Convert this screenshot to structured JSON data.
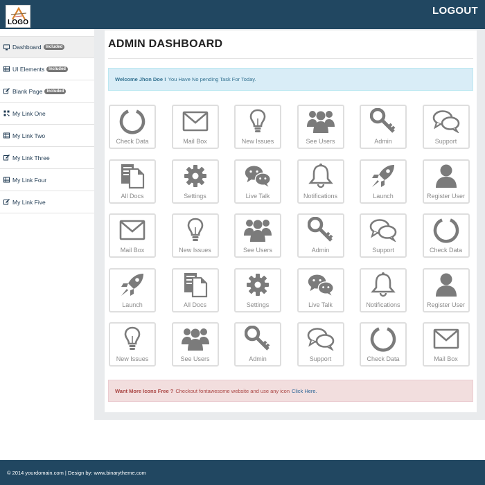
{
  "header": {
    "logo_text": "LOGO",
    "logout_label": "LOGOUT"
  },
  "sidebar": {
    "items": [
      {
        "label": "Dashboard",
        "badge": "Included",
        "icon": "desktop-icon",
        "active": true
      },
      {
        "label": "UI Elements",
        "badge": "Included",
        "icon": "table-icon",
        "active": false
      },
      {
        "label": "Blank Page",
        "badge": "Included",
        "icon": "edit-icon",
        "active": false
      },
      {
        "label": "My Link One",
        "badge": "",
        "icon": "qrcode-icon",
        "active": false
      },
      {
        "label": "My Link Two",
        "badge": "",
        "icon": "table-icon",
        "active": false
      },
      {
        "label": "My Link Three",
        "badge": "",
        "icon": "edit-icon",
        "active": false
      },
      {
        "label": "My Link Four",
        "badge": "",
        "icon": "table-icon",
        "active": false
      },
      {
        "label": "My Link Five",
        "badge": "",
        "icon": "edit-icon",
        "active": false
      }
    ]
  },
  "main": {
    "title": "ADMIN DASHBOARD",
    "welcome": {
      "strong": "Welcome Jhon Doe !",
      "text": "You Have No pending Task For Today."
    },
    "tiles": [
      {
        "label": "Check Data",
        "icon": "circle-notch-icon"
      },
      {
        "label": "Mail Box",
        "icon": "envelope-icon"
      },
      {
        "label": "New Issues",
        "icon": "lightbulb-icon"
      },
      {
        "label": "See Users",
        "icon": "users-icon"
      },
      {
        "label": "Admin",
        "icon": "key-icon"
      },
      {
        "label": "Support",
        "icon": "comments-icon"
      },
      {
        "label": "All Docs",
        "icon": "files-icon"
      },
      {
        "label": "Settings",
        "icon": "gear-icon"
      },
      {
        "label": "Live Talk",
        "icon": "wechat-icon"
      },
      {
        "label": "Notifications",
        "icon": "bell-icon"
      },
      {
        "label": "Launch",
        "icon": "rocket-icon"
      },
      {
        "label": "Register User",
        "icon": "user-icon"
      },
      {
        "label": "Mail Box",
        "icon": "envelope-icon"
      },
      {
        "label": "New Issues",
        "icon": "lightbulb-icon"
      },
      {
        "label": "See Users",
        "icon": "users-icon"
      },
      {
        "label": "Admin",
        "icon": "key-icon"
      },
      {
        "label": "Support",
        "icon": "comments-icon"
      },
      {
        "label": "Check Data",
        "icon": "circle-notch-icon"
      },
      {
        "label": "Launch",
        "icon": "rocket-icon"
      },
      {
        "label": "All Docs",
        "icon": "files-icon"
      },
      {
        "label": "Settings",
        "icon": "gear-icon"
      },
      {
        "label": "Live Talk",
        "icon": "wechat-icon"
      },
      {
        "label": "Notifications",
        "icon": "bell-icon"
      },
      {
        "label": "Register User",
        "icon": "user-icon"
      },
      {
        "label": "New Issues",
        "icon": "lightbulb-icon"
      },
      {
        "label": "See Users",
        "icon": "users-icon"
      },
      {
        "label": "Admin",
        "icon": "key-icon"
      },
      {
        "label": "Support",
        "icon": "comments-icon"
      },
      {
        "label": "Check Data",
        "icon": "circle-notch-icon"
      },
      {
        "label": "Mail Box",
        "icon": "envelope-icon"
      }
    ],
    "more_icons": {
      "strong": "Want More Icons Free ?",
      "text": "Checkout fontawesome website and use any icon",
      "link": "Click Here."
    }
  },
  "footer": {
    "text": "© 2014 yourdomain.com | Design by: www.binarytheme.com"
  },
  "colors": {
    "header_bg": "#214761",
    "icon_gray": "#7b7b7b",
    "info_bg": "#d9edf7",
    "danger_bg": "#f2dede"
  }
}
